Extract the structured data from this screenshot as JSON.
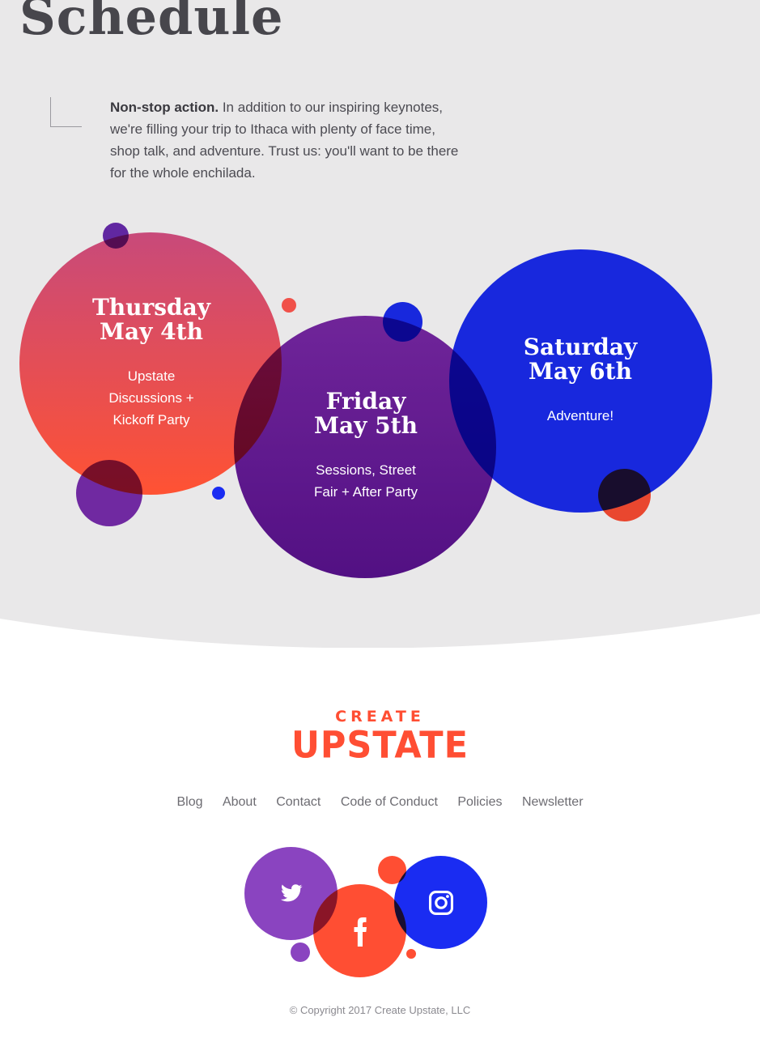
{
  "page": {
    "title": "Schedule",
    "intro_bold": "Non-stop action.",
    "intro_text": " In addition to our inspiring keynotes, we're filling your trip to Ithaca with plenty of face time, shop talk, and adventure. Trust us: you'll want to be there for the whole enchilada."
  },
  "days": [
    {
      "line1": "Thursday",
      "line2": "May 4th",
      "desc1": "Upstate",
      "desc2": "Discussions +",
      "desc3": "Kickoff Party"
    },
    {
      "line1": "Friday",
      "line2": "May 5th",
      "desc1": "Sessions, Street",
      "desc2": "Fair + After Party"
    },
    {
      "line1": "Saturday",
      "line2": "May 6th",
      "desc1": "Adventure!"
    }
  ],
  "footer": {
    "logo_line1": "CREATE",
    "logo_line2": "UPSTATE",
    "nav": [
      "Blog",
      "About",
      "Contact",
      "Code of Conduct",
      "Policies",
      "Newsletter"
    ],
    "social": [
      {
        "name": "twitter-icon",
        "color": "#8a44c0"
      },
      {
        "name": "facebook-icon",
        "color": "#ff4e33"
      },
      {
        "name": "instagram-icon",
        "color": "#1a2cf2"
      }
    ],
    "copyright": "© Copyright 2017 Create Upstate, LLC"
  },
  "colors": {
    "background": "#e9e8e9",
    "red": "#ff4e33",
    "purple": "#6b1fa0",
    "blue": "#1a2cf2",
    "text": "#47464c"
  }
}
